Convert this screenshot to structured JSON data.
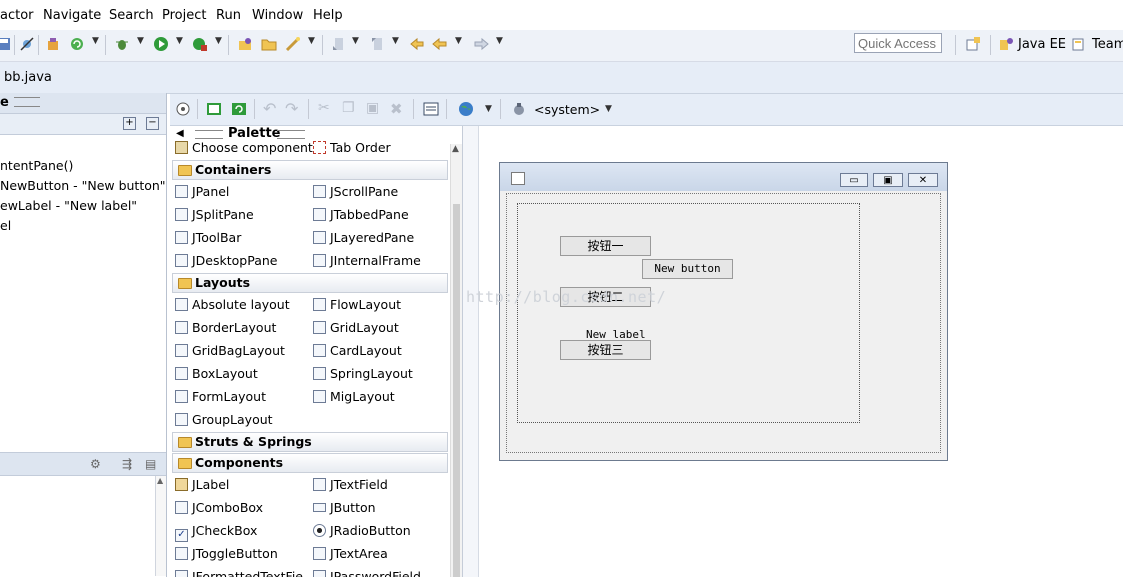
{
  "menu": [
    "actor",
    "Navigate",
    "Search",
    "Project",
    "Run",
    "Window",
    "Help"
  ],
  "toolbar": {
    "quick_access_placeholder": "Quick Access",
    "perspective_java_ee": "Java EE",
    "perspective_team": "Team"
  },
  "editor_tab": "bb.java",
  "left_panel": {
    "partial_tab": "e",
    "tree_lines": [
      "ntentPane()",
      "NewButton - \"New button\"",
      "ewLabel - \"New label\"",
      "el"
    ]
  },
  "design_toolbar": {
    "system_label": "<system>"
  },
  "palette": {
    "title": "Palette",
    "choose_component": "Choose component",
    "tab_order": "Tab Order",
    "categories": {
      "containers": "Containers",
      "layouts": "Layouts",
      "struts": "Struts & Springs",
      "components": "Components"
    },
    "containers": [
      "JPanel",
      "JScrollPane",
      "JSplitPane",
      "JTabbedPane",
      "JToolBar",
      "JLayeredPane",
      "JDesktopPane",
      "JInternalFrame"
    ],
    "layouts": [
      "Absolute layout",
      "FlowLayout",
      "BorderLayout",
      "GridLayout",
      "GridBagLayout",
      "CardLayout",
      "BoxLayout",
      "SpringLayout",
      "FormLayout",
      "MigLayout",
      "GroupLayout"
    ],
    "components": [
      "JLabel",
      "JTextField",
      "JComboBox",
      "JButton",
      "JCheckBox",
      "JRadioButton",
      "JToggleButton",
      "JTextArea",
      "JFormattedTextFie",
      "JPasswordField"
    ]
  },
  "design_frame": {
    "button1": "按钮一",
    "new_button": "New button",
    "button2": "按钮二",
    "new_label": "New label",
    "button3": "按钮三",
    "watermark": "http://blog.csdn.net/"
  }
}
